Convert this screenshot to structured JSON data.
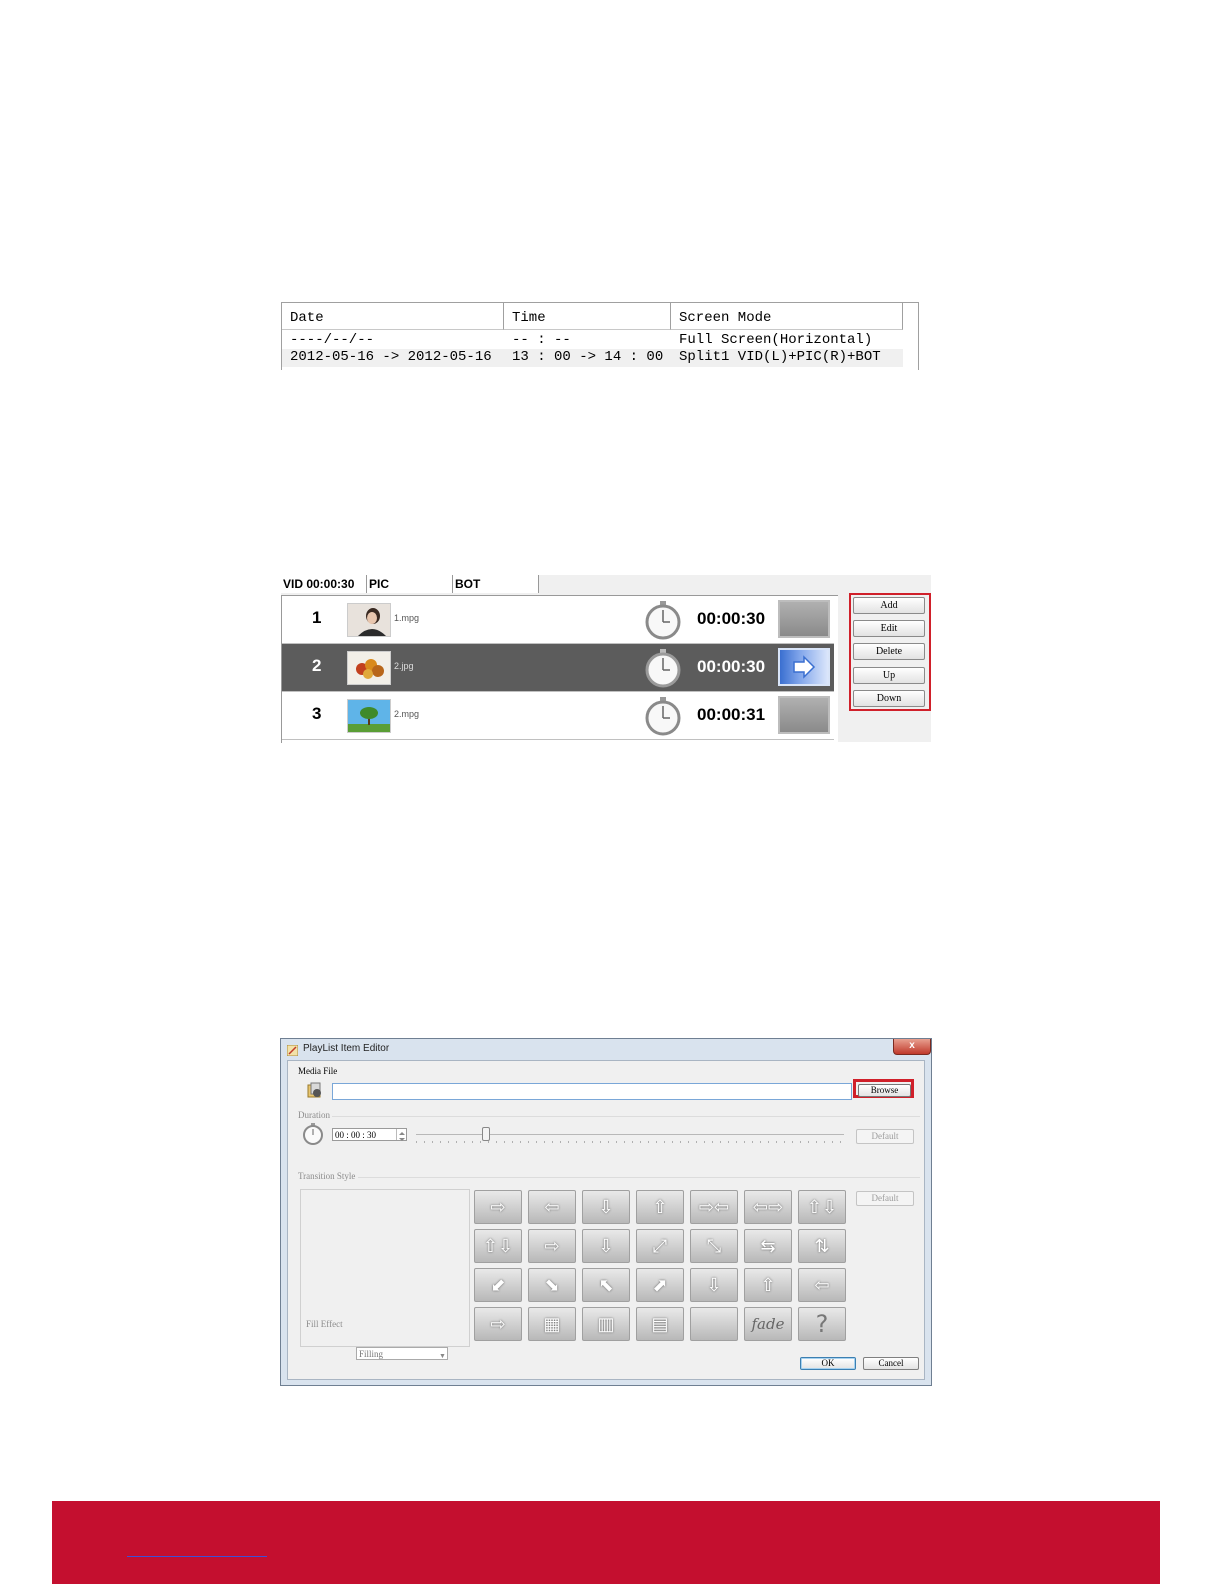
{
  "schedule": {
    "columns": [
      "Date",
      "Time",
      "Screen Mode"
    ],
    "rows": [
      [
        "----/--/--",
        "-- : --",
        "Full Screen(Horizontal)"
      ],
      [
        "2012-05-16 -> 2012-05-16",
        "13 : 00 -> 14 : 00",
        "Split1 VID(L)+PIC(R)+BOT"
      ]
    ]
  },
  "playlist": {
    "tabs": [
      "VID 00:00:30",
      "PIC",
      "BOT"
    ],
    "items": [
      {
        "num": "1",
        "file": "1.mpg",
        "duration": "00:00:30",
        "selected": false
      },
      {
        "num": "2",
        "file": "2.jpg",
        "duration": "00:00:30",
        "selected": true
      },
      {
        "num": "3",
        "file": "2.mpg",
        "duration": "00:00:31",
        "selected": false
      }
    ],
    "buttons": [
      "Add",
      "Edit",
      "Delete",
      "Up",
      "Down"
    ],
    "highlight_color": "#d0202a"
  },
  "dialog": {
    "title": "PlayList Item Editor",
    "close_label": "x",
    "media_file_label": "Media File",
    "media_file_value": "",
    "browse_label": "Browse",
    "duration_label": "Duration",
    "duration_value": "00 : 00 : 30",
    "duration_default_label": "Default",
    "transition_label": "Transition Style",
    "transition_default_label": "Default",
    "fill_effect_label": "Fill Effect",
    "fill_effect_value": "Filling",
    "transitions": [
      {
        "icon": "arrow-right-icon",
        "glyph": "⇨"
      },
      {
        "icon": "arrow-left-icon",
        "glyph": "⇦"
      },
      {
        "icon": "arrow-down-icon",
        "glyph": "⇩"
      },
      {
        "icon": "arrow-up-icon",
        "glyph": "⇧"
      },
      {
        "icon": "arrows-in-horizontal-icon",
        "glyph": "⇨⇦"
      },
      {
        "icon": "arrows-out-horizontal-icon",
        "glyph": "⇦⇨"
      },
      {
        "icon": "arrows-up-down-icon",
        "glyph": "⇧⇩"
      },
      {
        "icon": "split-vertical-icon",
        "glyph": "⇧⇩"
      },
      {
        "icon": "blinds-right-icon",
        "glyph": "⇨"
      },
      {
        "icon": "blinds-down-icon",
        "glyph": "⇩"
      },
      {
        "icon": "expand-corners-icon",
        "glyph": "⤢"
      },
      {
        "icon": "collapse-corners-icon",
        "glyph": "⤡"
      },
      {
        "icon": "interleave-horizontal-icon",
        "glyph": "⇆"
      },
      {
        "icon": "interleave-vertical-icon",
        "glyph": "⇅"
      },
      {
        "icon": "stairs-down-left-icon",
        "glyph": "⬋"
      },
      {
        "icon": "stairs-down-right-icon",
        "glyph": "⬊"
      },
      {
        "icon": "stairs-up-left-icon",
        "glyph": "⬉"
      },
      {
        "icon": "stairs-up-right-icon",
        "glyph": "⬈"
      },
      {
        "icon": "push-down-icon",
        "glyph": "⇩"
      },
      {
        "icon": "push-up-icon",
        "glyph": "⇧"
      },
      {
        "icon": "push-left-icon",
        "glyph": "⇦"
      },
      {
        "icon": "push-right-icon",
        "glyph": "⇨"
      },
      {
        "icon": "dissolve-checker-icon",
        "glyph": "▦"
      },
      {
        "icon": "vertical-lines-icon",
        "glyph": "▥"
      },
      {
        "icon": "horizontal-lines-icon",
        "glyph": "▤"
      },
      {
        "icon": "plain-gray-icon",
        "glyph": ""
      },
      {
        "icon": "fade-icon",
        "glyph": "fade"
      },
      {
        "icon": "random-question-icon",
        "glyph": "?"
      }
    ],
    "ok_label": "OK",
    "cancel_label": "Cancel"
  },
  "colors": {
    "footer": "#c40f2f",
    "selected_row": "#5c5c5c",
    "dialog_frame": "#d9e3ee"
  }
}
